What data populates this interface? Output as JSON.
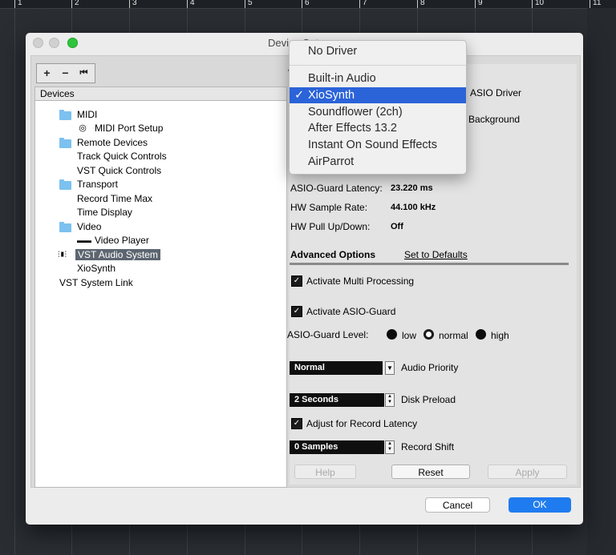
{
  "ruler": {
    "marks": [
      "1",
      "2",
      "3",
      "4",
      "5",
      "6",
      "7",
      "8",
      "9",
      "10",
      "11"
    ]
  },
  "window": {
    "title": "Device Setup",
    "toolbar": {
      "add": "+",
      "remove": "−",
      "reset": "⏮"
    },
    "devices_header": "Devices",
    "tree": [
      {
        "label": "MIDI",
        "type": "folder"
      },
      {
        "label": "MIDI Port Setup",
        "type": "midi"
      },
      {
        "label": "Remote Devices",
        "type": "folder"
      },
      {
        "label": "Track Quick Controls",
        "type": "item"
      },
      {
        "label": "VST Quick Controls",
        "type": "item"
      },
      {
        "label": "Transport",
        "type": "folder"
      },
      {
        "label": "Record Time Max",
        "type": "item"
      },
      {
        "label": "Time Display",
        "type": "item"
      },
      {
        "label": "Video",
        "type": "folder"
      },
      {
        "label": "Video Player",
        "type": "video"
      },
      {
        "label": "VST Audio System",
        "type": "audio",
        "selected": true
      },
      {
        "label": "XioSynth",
        "type": "item"
      },
      {
        "label": "VST System Link",
        "type": "root"
      }
    ],
    "right": {
      "heading_partial": "V",
      "asio_driver_label": "ASIO Driver",
      "background_label": "Background",
      "asio_guard_latency_label": "ASIO-Guard Latency:",
      "asio_guard_latency_value": "23.220 ms",
      "hw_sample_rate_label": "HW Sample Rate:",
      "hw_sample_rate_value": "44.100 kHz",
      "hw_pull_label": "HW Pull Up/Down:",
      "hw_pull_value": "Off",
      "advanced_options": "Advanced Options",
      "set_to_defaults": "Set to Defaults",
      "activate_multi": "Activate Multi Processing",
      "activate_asio_guard": "Activate ASIO-Guard",
      "asio_guard_level_label": "ASIO-Guard Level:",
      "levels": [
        "low",
        "normal",
        "high"
      ],
      "audio_priority_value": "Normal",
      "audio_priority_label": "Audio Priority",
      "disk_preload_value": "2 Seconds",
      "disk_preload_label": "Disk Preload",
      "adjust_record_latency": "Adjust for Record Latency",
      "record_shift_value": "0 Samples",
      "record_shift_label": "Record Shift",
      "help": "Help",
      "reset": "Reset",
      "apply": "Apply"
    },
    "cancel": "Cancel",
    "ok": "OK"
  },
  "menu": {
    "items": [
      "No Driver",
      "Built-in Audio",
      "XioSynth",
      "Soundflower (2ch)",
      "After Effects 13.2",
      "Instant On Sound Effects",
      "AirParrot"
    ],
    "selected_index": 2,
    "checkmark": "✓"
  },
  "colors": {
    "highlight": "#2b63d8",
    "ok_button": "#1f7cf0",
    "folder": "#7cc1ef"
  }
}
